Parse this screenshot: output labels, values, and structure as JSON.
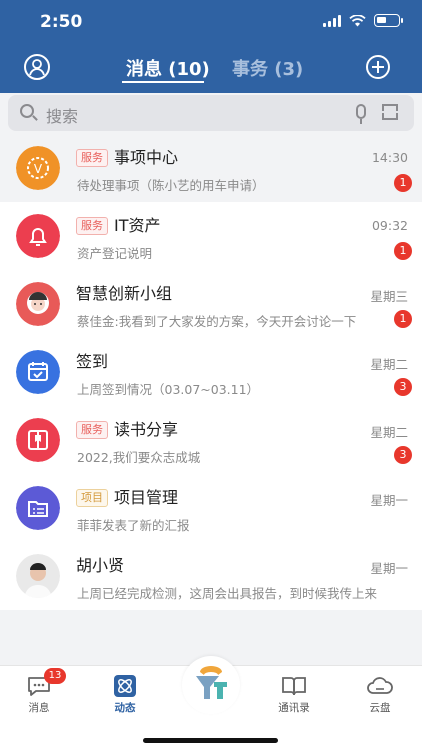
{
  "status": {
    "time": "2:50"
  },
  "tabs": {
    "messages": "消息 (10)",
    "tasks": "事务 (3)"
  },
  "search": {
    "placeholder": "搜索"
  },
  "messages": [
    {
      "tag": "服务",
      "title": "事项中心",
      "subtitle": "待处理事项（陈小艺的用车申请）",
      "time": "14:30",
      "badge": "1"
    },
    {
      "tag": "服务",
      "title": "IT资产",
      "subtitle": "资产登记说明",
      "time": "09:32",
      "badge": "1"
    },
    {
      "tag": "",
      "title": "智慧创新小组",
      "subtitle": "蔡佳金:我看到了大家发的方案，今天开会讨论一下",
      "time": "星期三",
      "badge": "1"
    },
    {
      "tag": "",
      "title": "签到",
      "subtitle": "上周签到情况（03.07~03.11）",
      "time": "星期二",
      "badge": "3"
    },
    {
      "tag": "服务",
      "title": "读书分享",
      "subtitle": "2022,我们要众志成城",
      "time": "星期二",
      "badge": "3"
    },
    {
      "tag": "项目",
      "title": "项目管理",
      "subtitle": "菲菲发表了新的汇报",
      "time": "星期一",
      "badge": ""
    },
    {
      "tag": "",
      "title": "胡小贤",
      "subtitle": "上周已经完成检测，这周会出具报告，到时候我传上来",
      "time": "星期一",
      "badge": ""
    }
  ],
  "tabbar": {
    "messages": "消息",
    "messages_badge": "13",
    "feed": "动态",
    "contacts": "通讯录",
    "cloud": "云盘"
  },
  "colors": {
    "header": "#2f62a3",
    "badge": "#e8372c",
    "orange": "#f09227",
    "red": "#ec3e4f",
    "blue": "#3872e0",
    "purple": "#5c5ad6"
  }
}
